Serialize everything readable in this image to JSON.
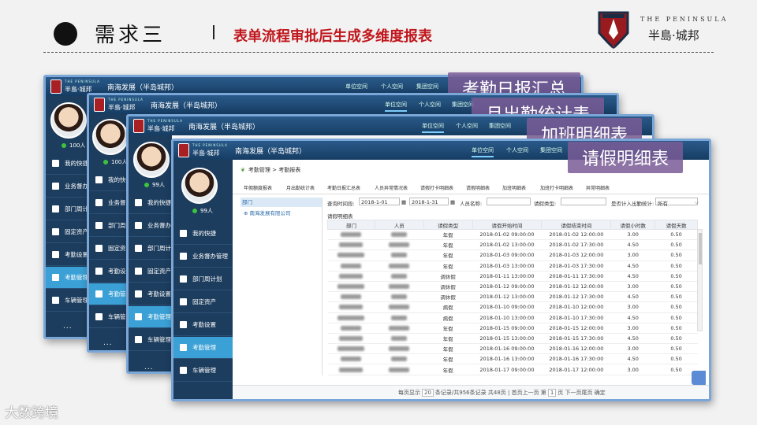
{
  "slide": {
    "title": "需求三",
    "subtitle": "表单流程审批后生成多维度报表",
    "logo_top": "THE PENINSULA",
    "logo_name": "半島·城邦",
    "watermark": "大数跨境"
  },
  "windows": [
    {
      "label": "考勤日报汇总",
      "company": "南海发展（半岛城邦）",
      "brand_small": "THE PENINSULA",
      "brand_name": "半島·城邦",
      "nav": [
        "单位空间",
        "个人空间",
        "集团空间"
      ],
      "user_count": "100人",
      "side": [
        "我的快捷",
        "业务督办管理",
        "部门周计划",
        "固定资产",
        "考勤设置",
        "考勤管理",
        "车辆管理"
      ],
      "more": "..."
    },
    {
      "label": "月出勤统计表",
      "company": "南海发展（半岛城邦）",
      "brand_small": "THE PENINSULA",
      "brand_name": "半島·城邦",
      "nav": [
        "单位空间",
        "个人空间",
        "集团空间"
      ],
      "user_count": "100人",
      "side": [
        "我的快捷",
        "业务督办管",
        "部门周计划",
        "固定资产",
        "考勤设置",
        "考勤管理",
        "车辆管理"
      ],
      "more": "..."
    },
    {
      "label": "加班明细表",
      "company": "南海发展（半岛城邦）",
      "brand_small": "THE PENINSULA",
      "brand_name": "半島·城邦",
      "nav": [
        "单位空间",
        "个人空间",
        "集团空间"
      ],
      "user_count": "99人",
      "side": [
        "我的快捷",
        "业务督办管",
        "部门周计划",
        "固定资产",
        "考勤设置",
        "考勤管理",
        "车辆管理"
      ],
      "more": "..."
    },
    {
      "label": "请假明细表",
      "company": "南海发展（半岛城邦）",
      "brand_small": "THE PENINSULA",
      "brand_name": "半島·城邦",
      "nav": [
        "单位空间",
        "个人空间",
        "集团空间"
      ],
      "user_count": "99人",
      "side": [
        "我的快捷",
        "业务督办管理",
        "部门周计划",
        "固定资产",
        "考勤设置",
        "考勤管理",
        "车辆管理"
      ],
      "more": "..."
    }
  ],
  "front": {
    "breadcrumb": "考勤管理 > 考勤报表",
    "report_tabs": [
      "年假额度报表",
      "月出勤统计表",
      "考勤日报汇总表",
      "人员异常情况表",
      "请假打卡明细表",
      "请假明细表",
      "加班明细表",
      "加班打卡明细表",
      "异常明细表"
    ],
    "tree_head": "部门",
    "tree_node": "南海发展有限公司",
    "filter": {
      "query_label": "查询时间段:",
      "date_from": "2018-1-01",
      "date_to": "2018-1-31",
      "person_label": "人员名称:",
      "type_label": "请假类型:",
      "counted_label": "是否计入出勤统计:",
      "counted_value": "所有"
    },
    "grid_title": "请假明细表",
    "columns": [
      "部门",
      "人员",
      "请假类型",
      "请假开始时间",
      "请假结束时间",
      "请假小时数",
      "请假天数"
    ],
    "rows": [
      [
        "年假",
        "2018-01-02 09:00:00",
        "2018-01-02 12:00:00",
        "3.00",
        "0.50"
      ],
      [
        "年假",
        "2018-01-02 13:00:00",
        "2018-01-02 17:30:00",
        "4.50",
        "0.50"
      ],
      [
        "年假",
        "2018-01-03 09:00:00",
        "2018-01-03 12:00:00",
        "3.00",
        "0.50"
      ],
      [
        "年假",
        "2018-01-03 13:00:00",
        "2018-01-03 17:30:00",
        "4.50",
        "0.50"
      ],
      [
        "调休假",
        "2018-01-11 13:00:00",
        "2018-01-11 17:30:00",
        "4.50",
        "0.50"
      ],
      [
        "调休假",
        "2018-01-12 09:00:00",
        "2018-01-12 12:00:00",
        "3.00",
        "0.50"
      ],
      [
        "调休假",
        "2018-01-12 13:00:00",
        "2018-01-12 17:30:00",
        "4.50",
        "0.50"
      ],
      [
        "病假",
        "2018-01-10 09:00:00",
        "2018-01-10 12:00:00",
        "3.00",
        "0.50"
      ],
      [
        "病假",
        "2018-01-10 13:00:00",
        "2018-01-10 17:30:00",
        "4.50",
        "0.50"
      ],
      [
        "年假",
        "2018-01-15 09:00:00",
        "2018-01-15 12:00:00",
        "3.00",
        "0.50"
      ],
      [
        "年假",
        "2018-01-15 13:00:00",
        "2018-01-15 17:30:00",
        "4.50",
        "0.50"
      ],
      [
        "年假",
        "2018-01-16 09:00:00",
        "2018-01-16 12:00:00",
        "3.00",
        "0.50"
      ],
      [
        "年假",
        "2018-01-16 13:00:00",
        "2018-01-16 17:30:00",
        "4.50",
        "0.50"
      ],
      [
        "年假",
        "2018-01-17 09:00:00",
        "2018-01-17 12:00:00",
        "3.00",
        "0.50"
      ]
    ],
    "pager": {
      "before_size": "每页显示",
      "page_size": "20",
      "summary": "条记录/共956条记录 共48页 | 首页上一页 第",
      "page": "1",
      "after": "页 下一页尾页 确定"
    }
  }
}
